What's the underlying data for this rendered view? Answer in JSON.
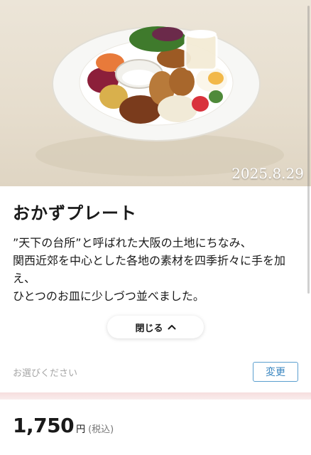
{
  "hero": {
    "image_alt": "おかずプレートの写真",
    "date_stamp": "2025.8.29"
  },
  "product": {
    "title": "おかずプレート",
    "description": "”天下の台所”と呼ばれた大阪の土地にちなみ、\n関西近郊を中心とした各地の素材を四季折々に手を加え、\nひとつのお皿に少しづつ並べました。"
  },
  "actions": {
    "close_label": "閉じる",
    "close_icon": "chevron-up-icon",
    "select_placeholder": "お選びください",
    "change_label": "変更"
  },
  "price": {
    "amount": "1,750",
    "unit": "円",
    "tax_note": "(税込)"
  },
  "colors": {
    "accent_blue": "#3a86c0",
    "divider_pink": "#f6dede"
  }
}
